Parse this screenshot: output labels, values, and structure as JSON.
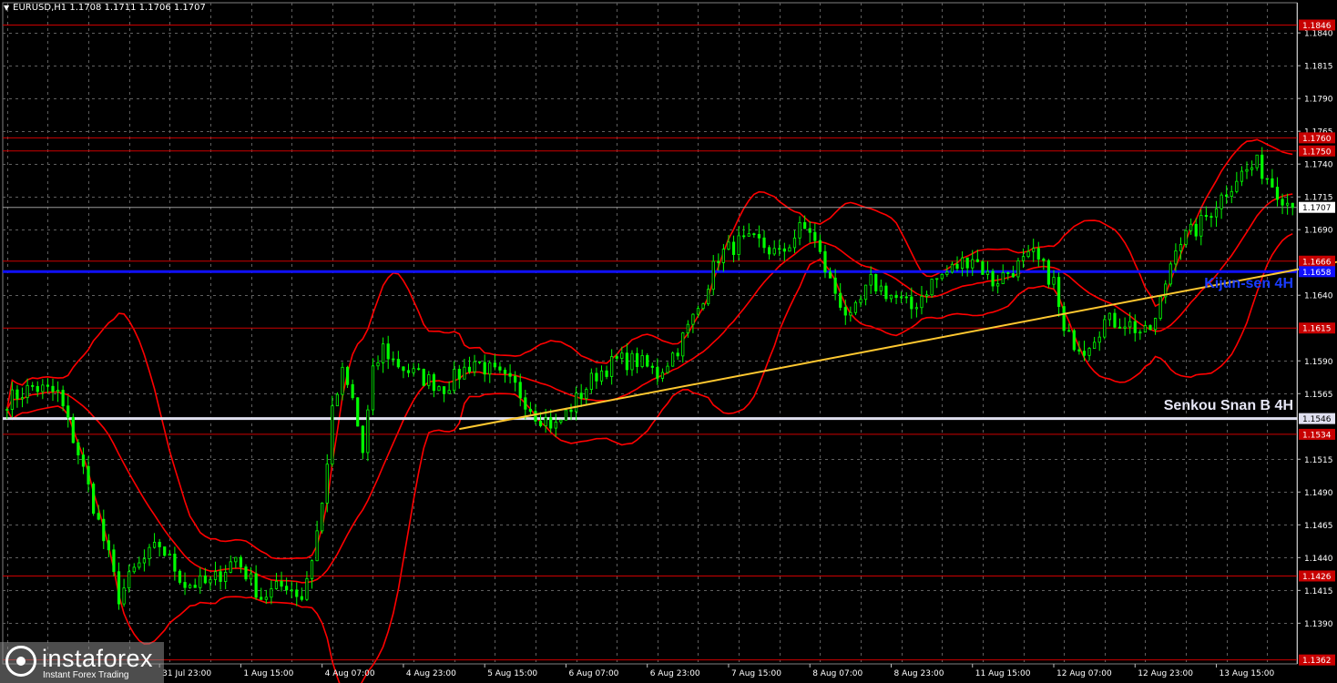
{
  "header": {
    "symbol_line": "EURUSD,H1  1.1708 1.1711 1.1706 1.1707"
  },
  "logo": {
    "brand": "instaforex",
    "tagline": "Instant Forex Trading"
  },
  "chart_data": {
    "type": "candlestick",
    "symbol": "EURUSD",
    "timeframe": "H1",
    "ohlc_current": {
      "open": 1.1708,
      "high": 1.1711,
      "low": 1.1706,
      "close": 1.1707
    },
    "ylim": [
      1.1359,
      1.1863
    ],
    "y_ticks": [
      "1.1840",
      "1.1815",
      "1.1790",
      "1.1765",
      "1.1740",
      "1.1715",
      "1.1690",
      "1.1640",
      "1.1590",
      "1.1565",
      "1.1515",
      "1.1490",
      "1.1465",
      "1.1440",
      "1.1415",
      "1.1390"
    ],
    "x_ticks": [
      "31 Jul 23:00",
      "1 Aug 15:00",
      "4 Aug 07:00",
      "4 Aug 23:00",
      "5 Aug 15:00",
      "6 Aug 07:00",
      "6 Aug 23:00",
      "7 Aug 15:00",
      "8 Aug 07:00",
      "8 Aug 23:00",
      "11 Aug 15:00",
      "12 Aug 07:00",
      "12 Aug 23:00",
      "13 Aug 15:00"
    ],
    "x_tick_index": [
      30,
      46,
      62,
      78,
      94,
      110,
      126,
      142,
      158,
      174,
      190,
      206,
      222,
      238
    ],
    "bar_count": 254,
    "price_path": [
      [
        0,
        1.156
      ],
      [
        5,
        1.157
      ],
      [
        10,
        1.1565
      ],
      [
        14,
        1.152
      ],
      [
        17,
        1.148
      ],
      [
        20,
        1.144
      ],
      [
        22,
        1.141
      ],
      [
        25,
        1.143
      ],
      [
        30,
        1.145
      ],
      [
        35,
        1.142
      ],
      [
        40,
        1.142
      ],
      [
        45,
        1.144
      ],
      [
        50,
        1.141
      ],
      [
        55,
        1.142
      ],
      [
        58,
        1.141
      ],
      [
        60,
        1.144
      ],
      [
        62,
        1.148
      ],
      [
        64,
        1.155
      ],
      [
        66,
        1.158
      ],
      [
        68,
        1.156
      ],
      [
        70,
        1.152
      ],
      [
        72,
        1.158
      ],
      [
        74,
        1.16
      ],
      [
        76,
        1.159
      ],
      [
        80,
        1.158
      ],
      [
        86,
        1.157
      ],
      [
        92,
        1.159
      ],
      [
        96,
        1.158
      ],
      [
        100,
        1.157
      ],
      [
        104,
        1.155
      ],
      [
        108,
        1.154
      ],
      [
        112,
        1.156
      ],
      [
        116,
        1.158
      ],
      [
        120,
        1.159
      ],
      [
        124,
        1.159
      ],
      [
        128,
        1.158
      ],
      [
        132,
        1.16
      ],
      [
        136,
        1.163
      ],
      [
        140,
        1.167
      ],
      [
        144,
        1.168
      ],
      [
        148,
        1.168
      ],
      [
        152,
        1.167
      ],
      [
        156,
        1.169
      ],
      [
        158,
        1.169
      ],
      [
        162,
        1.165
      ],
      [
        166,
        1.162
      ],
      [
        170,
        1.165
      ],
      [
        174,
        1.164
      ],
      [
        178,
        1.163
      ],
      [
        182,
        1.165
      ],
      [
        186,
        1.166
      ],
      [
        190,
        1.167
      ],
      [
        194,
        1.165
      ],
      [
        198,
        1.166
      ],
      [
        202,
        1.167
      ],
      [
        206,
        1.165
      ],
      [
        208,
        1.161
      ],
      [
        212,
        1.16
      ],
      [
        216,
        1.162
      ],
      [
        220,
        1.162
      ],
      [
        224,
        1.161
      ],
      [
        226,
        1.162
      ],
      [
        230,
        1.168
      ],
      [
        234,
        1.169
      ],
      [
        238,
        1.171
      ],
      [
        242,
        1.173
      ],
      [
        246,
        1.174
      ],
      [
        250,
        1.172
      ],
      [
        253,
        1.1707
      ]
    ],
    "levels": [
      {
        "price": 1.1846,
        "label": "1.1846",
        "color": "#cc0000",
        "style": "solid"
      },
      {
        "price": 1.176,
        "label": "1.1760",
        "color": "#cc0000",
        "style": "solid"
      },
      {
        "price": 1.175,
        "label": "1.1750",
        "color": "#cc0000",
        "style": "solid"
      },
      {
        "price": 1.1707,
        "label": "1.1707",
        "color": "#9a9a9a",
        "style": "current"
      },
      {
        "price": 1.1666,
        "label": "1.1666",
        "color": "#cc0000",
        "style": "solid"
      },
      {
        "price": 1.1658,
        "label": "1.1658",
        "color": "#1010ff",
        "style": "thick",
        "name": "Kijun-sen 4H"
      },
      {
        "price": 1.1615,
        "label": "1.1615",
        "color": "#cc0000",
        "style": "solid"
      },
      {
        "price": 1.1546,
        "label": "1.1546",
        "color": "#e0e0f0",
        "style": "thick",
        "name": "Senkou Snan B 4H"
      },
      {
        "price": 1.1534,
        "label": "1.1534",
        "color": "#cc0000",
        "style": "solid"
      },
      {
        "price": 1.1426,
        "label": "1.1426",
        "color": "#cc0000",
        "style": "solid"
      },
      {
        "price": 1.1362,
        "label": "1.1362",
        "color": "#cc0000",
        "style": "solid"
      }
    ],
    "trendline": {
      "start": [
        89,
        1.1538
      ],
      "end": [
        268,
        1.167
      ],
      "color": "#ffc830"
    },
    "annotations": [
      {
        "text": "Kijun-sen 4H",
        "color": "#1a3cff",
        "price": 1.165
      },
      {
        "text": "Senkou Snan B 4H",
        "color": "#e6e6f5",
        "price": 1.1557
      }
    ],
    "colors": {
      "background": "#000000",
      "candles": "#00ff00",
      "bands": "#ff0000",
      "grid": "#606060",
      "axis_text": "#ffffff"
    }
  }
}
